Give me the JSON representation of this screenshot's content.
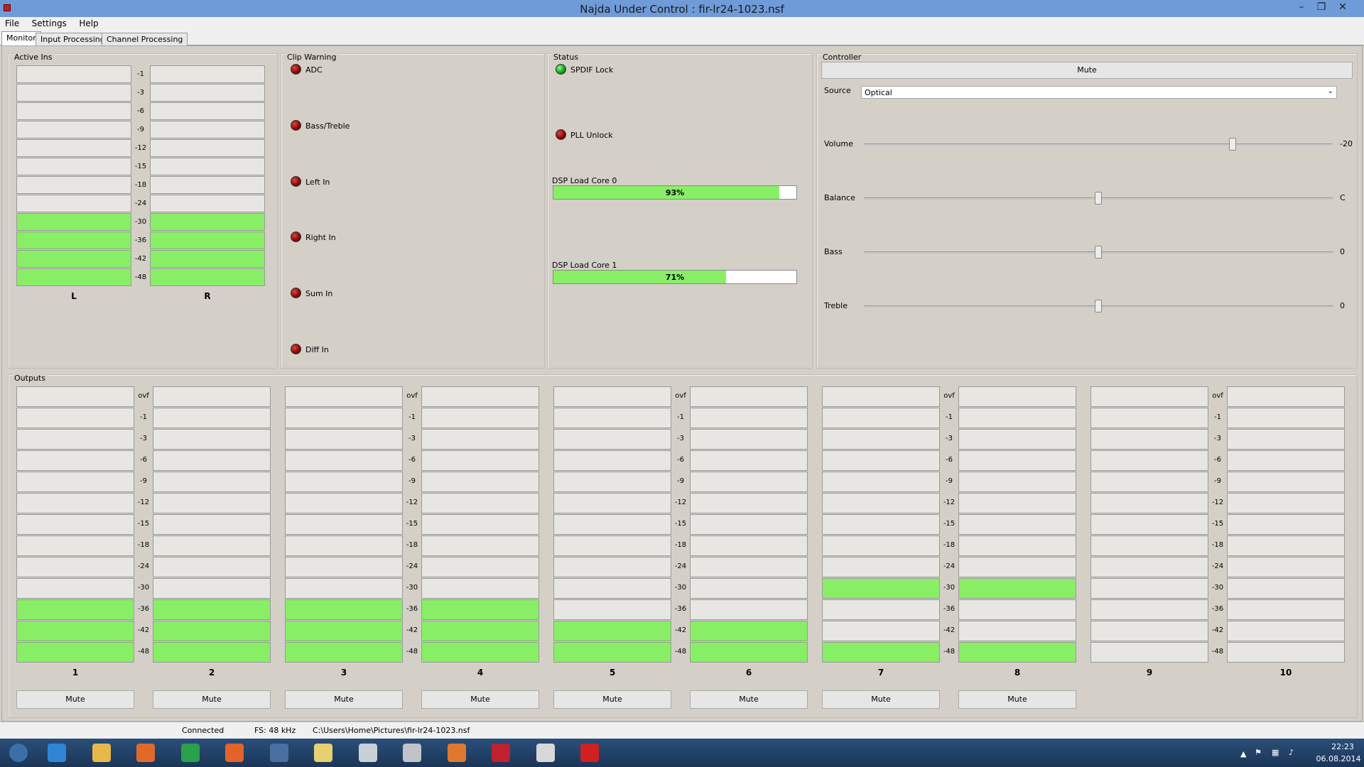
{
  "window": {
    "title": "Najda Under Control : fir-lr24-1023.nsf",
    "controls": {
      "minimize": "–",
      "restore": "❐",
      "close": "✕"
    }
  },
  "menu": [
    "File",
    "Settings",
    "Help"
  ],
  "tabs": [
    "Monitor",
    "Input Processing",
    "Channel Processing"
  ],
  "active_ins": {
    "label": "Active Ins",
    "ticks": [
      "-1",
      "-3",
      "-6",
      "-9",
      "-12",
      "-15",
      "-18",
      "-24",
      "-30",
      "-36",
      "-42",
      "-48"
    ],
    "channels": [
      {
        "name": "L",
        "lit": [
          false,
          false,
          false,
          false,
          false,
          false,
          false,
          false,
          true,
          true,
          true,
          true
        ]
      },
      {
        "name": "R",
        "lit": [
          false,
          false,
          false,
          false,
          false,
          false,
          false,
          false,
          true,
          true,
          true,
          true
        ]
      }
    ]
  },
  "clip_warning": {
    "label": "Clip Warning",
    "items": [
      "ADC",
      "Bass/Treble",
      "Left In",
      "Right In",
      "Sum In",
      "Diff In"
    ]
  },
  "status": {
    "label": "Status",
    "spdif": "SPDIF Lock",
    "pll": "PLL Unlock",
    "cores": [
      {
        "label": "DSP Load Core 0",
        "value": 93,
        "text": "93%"
      },
      {
        "label": "DSP Load Core 1",
        "value": 71,
        "text": "71%"
      }
    ]
  },
  "controller": {
    "label": "Controller",
    "mute": "Mute",
    "source_label": "Source",
    "source_value": "Optical",
    "sliders": [
      {
        "label": "Volume",
        "value": "-20",
        "pos": 0.787
      },
      {
        "label": "Balance",
        "value": "C",
        "pos": 0.5
      },
      {
        "label": "Bass",
        "value": "0",
        "pos": 0.5
      },
      {
        "label": "Treble",
        "value": "0",
        "pos": 0.5
      }
    ]
  },
  "outputs": {
    "label": "Outputs",
    "ticks": [
      "ovf",
      "-1",
      "-3",
      "-6",
      "-9",
      "-12",
      "-15",
      "-18",
      "-24",
      "-30",
      "-36",
      "-42",
      "-48"
    ],
    "mute_label": "Mute",
    "channels": [
      {
        "name": "1",
        "lit": 3,
        "mute": true
      },
      {
        "name": "2",
        "lit": 3,
        "mute": true
      },
      {
        "name": "3",
        "lit": 3,
        "mute": true
      },
      {
        "name": "4",
        "lit": 3,
        "mute": true
      },
      {
        "name": "5",
        "lit": 2,
        "mute": true
      },
      {
        "name": "6",
        "lit": 2,
        "mute": true
      },
      {
        "name": "7",
        "lit": 4,
        "mute": true,
        "gap": [
          1,
          2
        ]
      },
      {
        "name": "8",
        "lit": 4,
        "mute": true,
        "gap": [
          1,
          2
        ]
      },
      {
        "name": "9",
        "lit": 0,
        "mute": false
      },
      {
        "name": "10",
        "lit": 0,
        "mute": false
      }
    ]
  },
  "statusbar": {
    "connection": "Connected",
    "fs": "FS: 48 kHz",
    "file": "C:\\Users\\Home\\Pictures\\fir-lr24-1023.nsf"
  },
  "taskbar": {
    "time": "22:23",
    "date": "06.08.2014",
    "apps": [
      "start-orb",
      "internet-explorer",
      "file-explorer",
      "media-player",
      "store",
      "firefox",
      "thunderbird",
      "folder",
      "app-window",
      "app-gray",
      "kmplayer",
      "dice-app",
      "paint",
      "najda-app"
    ]
  }
}
